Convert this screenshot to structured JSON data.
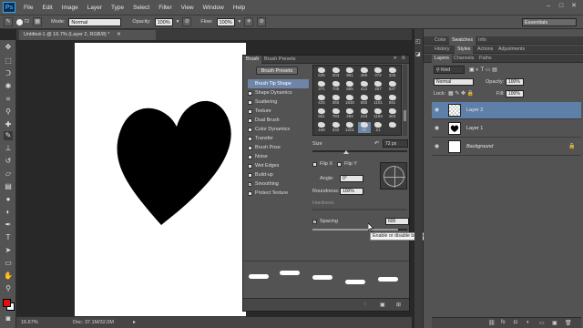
{
  "menubar": {
    "app_logo": "Ps",
    "items": [
      "File",
      "Edit",
      "Image",
      "Layer",
      "Type",
      "Select",
      "Filter",
      "View",
      "Window",
      "Help"
    ]
  },
  "options_bar": {
    "brush_size": "72",
    "mode_label": "Mode:",
    "mode_value": "Normal",
    "opacity_label": "Opacity:",
    "opacity_value": "100%",
    "flow_label": "Flow:",
    "flow_value": "100%",
    "workspace": "Essentials"
  },
  "document": {
    "tab_title": "Untitled-1 @ 16.7% (Layer 2, RGB/8) *",
    "zoom": "16.67%",
    "doc_size": "Doc: 37.1M/32.0M"
  },
  "brush_panel": {
    "tabs": [
      "Brush",
      "Brush Presets"
    ],
    "presets_button": "Brush Presets",
    "options": [
      {
        "label": "Brush Tip Shape",
        "checked": null,
        "selected": true
      },
      {
        "label": "Shape Dynamics",
        "checked": false,
        "selected": false
      },
      {
        "label": "Scattering",
        "checked": false,
        "selected": false
      },
      {
        "label": "Texture",
        "checked": false,
        "selected": false
      },
      {
        "label": "Dual Brush",
        "checked": false,
        "selected": false
      },
      {
        "label": "Color Dynamics",
        "checked": false,
        "selected": false
      },
      {
        "label": "Transfer",
        "checked": false,
        "selected": false
      },
      {
        "label": "Brush Pose",
        "checked": false,
        "selected": false
      },
      {
        "label": "Noise",
        "checked": false,
        "selected": false
      },
      {
        "label": "Wet Edges",
        "checked": false,
        "selected": false
      },
      {
        "label": "Build-up",
        "checked": false,
        "selected": false
      },
      {
        "label": "Smoothing",
        "checked": true,
        "selected": false
      },
      {
        "label": "Protect Texture",
        "checked": false,
        "selected": false
      }
    ],
    "tip_numbers": [
      "535",
      "203",
      "961",
      "490",
      "372",
      "326",
      "371",
      "705",
      "885",
      "412",
      "457",
      "527",
      "425",
      "365",
      "1630",
      "592",
      "1101",
      "591",
      "651",
      "784",
      "294",
      "243",
      "1194",
      "463",
      "448",
      "332",
      "1201",
      "72",
      "21",
      ""
    ],
    "size_label": "Size",
    "size_value": "72 px",
    "flip_x": "Flip X",
    "flip_y": "Flip Y",
    "angle_label": "Angle:",
    "angle_value": "0°",
    "roundness_label": "Roundness:",
    "roundness_value": "100%",
    "hardness_label": "Hardness",
    "spacing_label": "Spacing",
    "spacing_checked": true,
    "spacing_value": "600",
    "spacing_fraction": 0.9
  },
  "tooltip": {
    "text": "Enable or disable brush spacing"
  },
  "right_panels": {
    "top_tabs": [
      "Color",
      "Swatches",
      "Info"
    ],
    "mid_tabs": [
      "History",
      "Styles",
      "Actions",
      "Adjustments"
    ],
    "layers_tabs": [
      "Layers",
      "Channels",
      "Paths"
    ],
    "filter_kind": "Kind",
    "blend_mode": "Normal",
    "opacity_label": "Opacity:",
    "opacity_value": "100%",
    "lock_label": "Lock:",
    "fill_label": "Fill:",
    "fill_value": "100%",
    "layers": [
      {
        "name": "Layer 2",
        "selected": true,
        "thumb": "transparent"
      },
      {
        "name": "Layer 1",
        "selected": false,
        "thumb": "heart"
      },
      {
        "name": "Background",
        "selected": false,
        "thumb": "white",
        "locked": true
      }
    ]
  },
  "colors": {
    "foreground": "#e01010",
    "background": "#ffffff",
    "selection": "#5d7fa8"
  }
}
